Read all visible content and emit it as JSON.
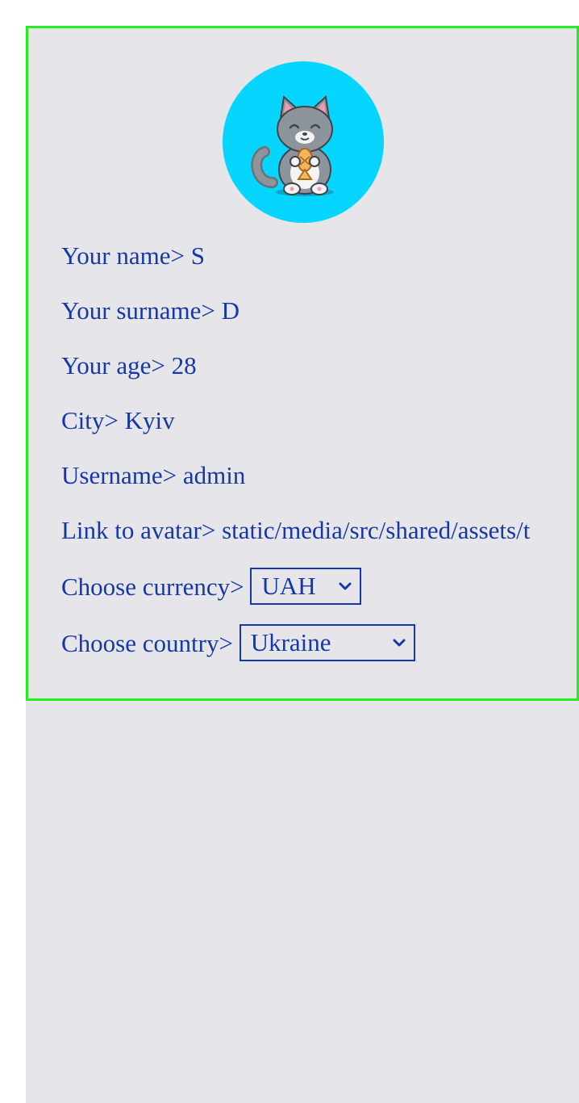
{
  "profile": {
    "avatar_icon": "cat-holding-fish-icon",
    "avatar_bg": "#06d6ff",
    "accent_color": "#1537a8",
    "panel_border_color": "#22ee22",
    "fields": {
      "name": {
        "label": "Your name> ",
        "value": "S"
      },
      "surname": {
        "label": "Your surname> ",
        "value": "D"
      },
      "age": {
        "label": "Your age> ",
        "value": "28"
      },
      "city": {
        "label": "City> ",
        "value": "Kyiv"
      },
      "username": {
        "label": "Username> ",
        "value": "admin"
      },
      "avatar_link": {
        "label": "Link to avatar> ",
        "value": "static/media/src/shared/assets/t"
      }
    },
    "currency": {
      "label": "Choose currency> ",
      "selected": "UAH"
    },
    "country": {
      "label": "Choose country> ",
      "selected": "Ukraine"
    }
  }
}
